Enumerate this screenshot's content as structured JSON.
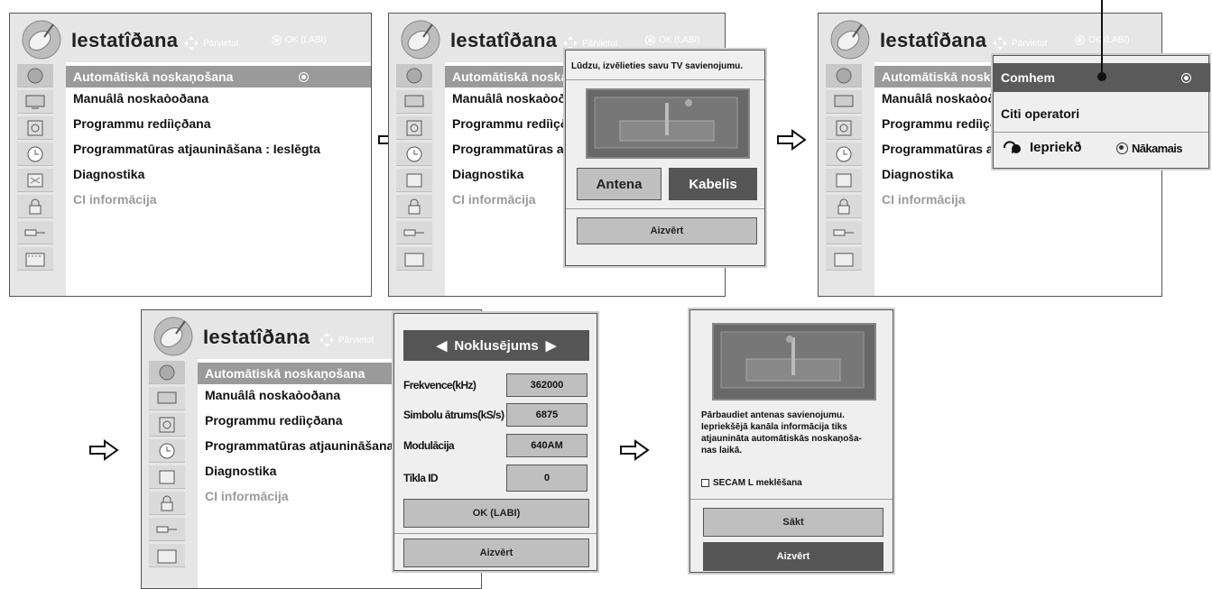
{
  "title": "Iestatîðana",
  "hints": {
    "move": "Pārvietot",
    "ok": "OK (LABI)"
  },
  "menu_items": [
    "Automātiskā noskaņošana",
    "Manuâlâ noskaòoðana",
    "Programmu rediìçðana",
    "Programmatūras atjaunināšana",
    "Diagnostika",
    "CI informācija"
  ],
  "menu_item_value": ": Ieslēgta",
  "icons": [
    "satellite-icon",
    "tv-icon",
    "speaker-icon",
    "clock-icon",
    "schedule-icon",
    "lock-icon",
    "input-plug-icon",
    "usb-media-icon"
  ],
  "popup2": {
    "title": "Lūdzu, izvēlieties savu TV savienojumu.",
    "antenna": "Antena",
    "cable": "Kabelis",
    "close": "Aizvērt"
  },
  "popup3": {
    "option1": "Comhem",
    "option2": "Citi operatori",
    "prev": "Iepriekð",
    "next": "Nākamais"
  },
  "popup4": {
    "preset": "Noklusējums",
    "fields": [
      {
        "label": "Frekvence(kHz)",
        "value": "362000"
      },
      {
        "label": "Simbolu ātrums(kS/s)",
        "value": "6875"
      },
      {
        "label": "Modulācija",
        "value": "640AM"
      },
      {
        "label": "Tīkla ID",
        "value": "0"
      }
    ],
    "ok": "OK (LABI)",
    "close": "Aizvērt"
  },
  "popup5": {
    "text": [
      "Pārbaudiet antenas savienojumu.",
      "Iepriekšējā kanāla informācija tiks",
      "atjaunināta automātiskās noskaņoša-",
      "nas laikā."
    ],
    "checkbox": "SECAM L meklēšana",
    "start": "Sākt",
    "close": "Aizvērt"
  },
  "colors": {
    "highlight": "#9a9a9a",
    "dark_button": "#555555",
    "panel_bg": "#e6e6e6"
  }
}
